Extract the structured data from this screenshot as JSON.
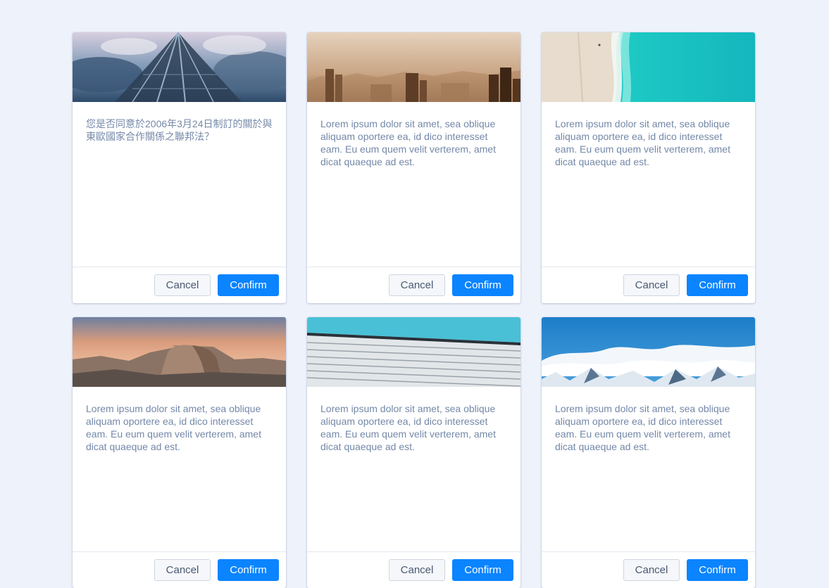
{
  "buttons": {
    "cancel_label": "Cancel",
    "confirm_label": "Confirm"
  },
  "cards": [
    {
      "image": "skyscraper-sky-image",
      "text": "您是否同意於2006年3月24日制訂的關於與東歐國家合作關係之聯邦法？"
    },
    {
      "image": "hazy-city-skyline-image",
      "text": "Lorem ipsum dolor sit amet, sea oblique aliquam oportere ea, id dico interesset eam. Eu eum quem velit verterem, amet dicat quaeque ad est."
    },
    {
      "image": "aerial-beach-image",
      "text": "Lorem ipsum dolor sit amet, sea oblique aliquam oportere ea, id dico interesset eam. Eu eum quem velit verterem, amet dicat quaeque ad est."
    },
    {
      "image": "half-dome-mountain-image",
      "text": "Lorem ipsum dolor sit amet, sea oblique aliquam oportere ea, id dico interesset eam. Eu eum quem velit verterem, amet dicat quaeque ad est."
    },
    {
      "image": "building-facade-image",
      "text": "Lorem ipsum dolor sit amet, sea oblique aliquam oportere ea, id dico interesset eam. Eu eum quem velit verterem, amet dicat quaeque ad est."
    },
    {
      "image": "snowy-mountains-clouds-image",
      "text": "Lorem ipsum dolor sit amet, sea oblique aliquam oportere ea, id dico interesset eam. Eu eum quem velit verterem, amet dicat quaeque ad est."
    }
  ],
  "colors": {
    "background": "#eef2fb",
    "accent": "#0a84ff",
    "body_text": "#7488a8"
  }
}
